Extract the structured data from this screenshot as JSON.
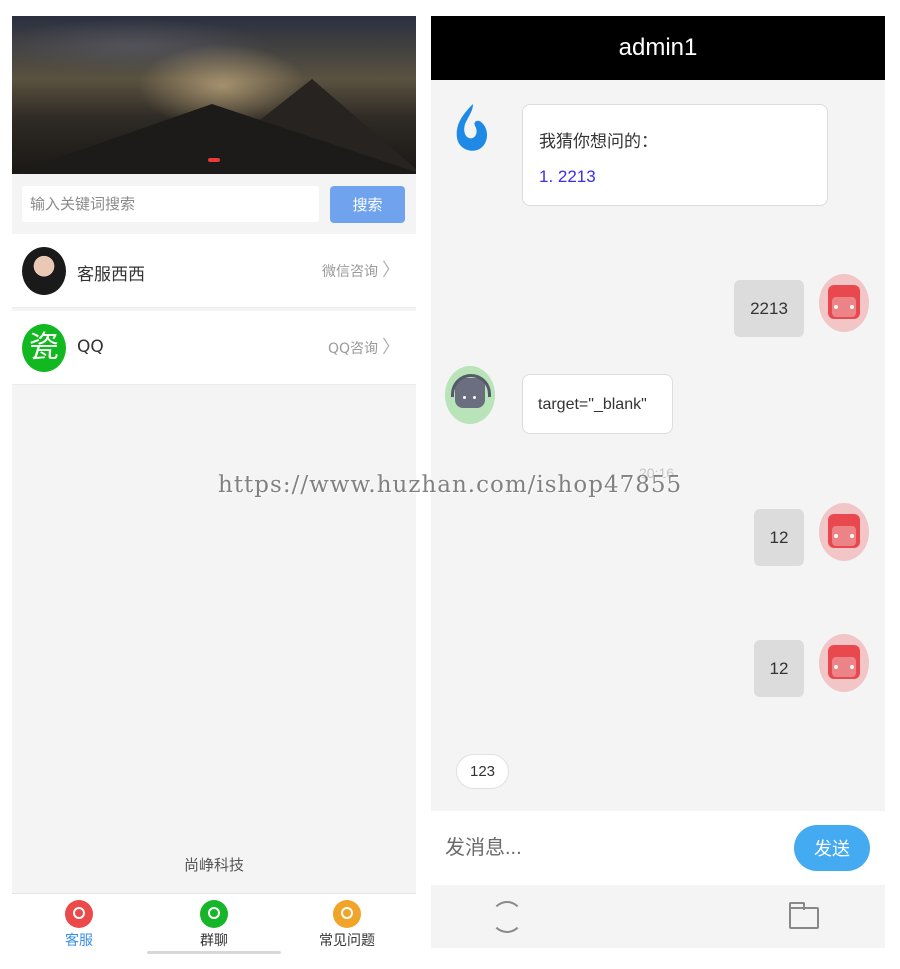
{
  "left_app": {
    "search": {
      "placeholder": "输入关键词搜索",
      "button_label": "搜索"
    },
    "contacts": [
      {
        "name": "客服西西",
        "action": "微信咨询",
        "avatar_icon": "woman-avatar-icon"
      },
      {
        "name": "QQ",
        "action": "QQ咨询",
        "avatar_icon": "qq-app-icon",
        "avatar_glyph": "瓷"
      }
    ],
    "chevron": "〉",
    "company": "尚峥科技",
    "tabs": [
      {
        "label": "客服",
        "icon": "headset-icon",
        "active": true,
        "color": "#ec4a4a"
      },
      {
        "label": "群聊",
        "icon": "group-chat-icon",
        "active": false,
        "color": "#17b529"
      },
      {
        "label": "常见问题",
        "icon": "faq-icon",
        "active": false,
        "color": "#f0a42a"
      }
    ]
  },
  "chat": {
    "title": "admin1",
    "bot_suggest": {
      "title": "我猜你想问的：",
      "link": "1. 2213"
    },
    "my_messages": [
      "2213",
      "12",
      "12"
    ],
    "agent_message": "target=\"_blank\"",
    "timestamp": "20:16",
    "quick_reply": "123",
    "composer": {
      "placeholder": "发消息...",
      "send_label": "发送"
    },
    "footer_icons": [
      "emoji-icon",
      "folder-icon"
    ]
  },
  "watermark": "https://www.huzhan.com/ishop47855",
  "colors": {
    "search_button": "#6fa3ee",
    "send_button": "#44aaf2",
    "header": "#000000",
    "link": "#3a2fe8",
    "active_tab": "#3a8ee6"
  }
}
